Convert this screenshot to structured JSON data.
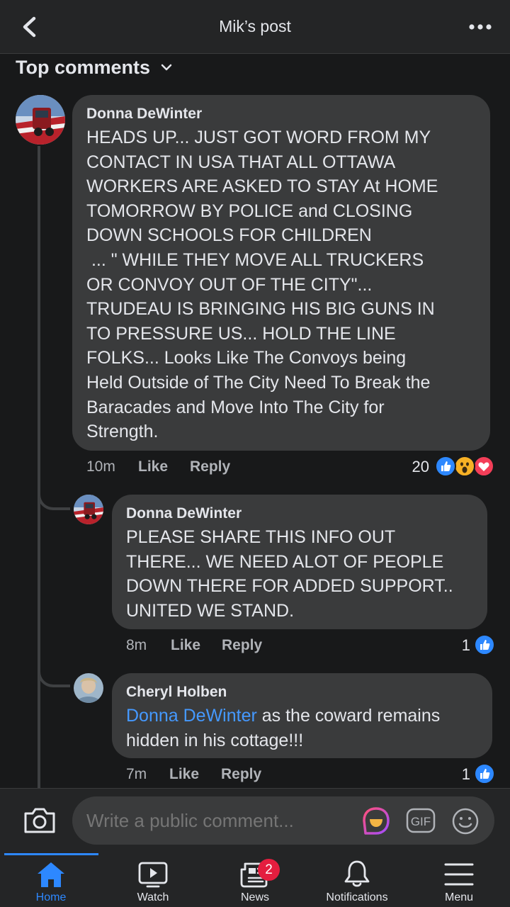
{
  "header": {
    "title": "Mik’s post"
  },
  "filter": {
    "label": "Top comments"
  },
  "comments": [
    {
      "author": "Donna DeWinter",
      "lines": [
        "HEADS UP... JUST GOT WORD FROM MY",
        "CONTACT IN USA THAT ALL OTTAWA",
        "WORKERS ARE ASKED TO STAY At HOME",
        "TOMORROW BY POLICE and CLOSING",
        "DOWN SCHOOLS FOR CHILDREN",
        " ... \" WHILE THEY MOVE ALL TRUCKERS",
        "OR CONVOY OUT OF THE CITY\"...",
        "TRUDEAU IS BRINGING HIS BIG GUNS IN",
        "TO PRESSURE US... HOLD THE LINE",
        "FOLKS... Looks Like The Convoys being",
        "Held Outside of The City Need To Break the",
        "Baracades and Move Into The City for",
        "Strength."
      ],
      "time": "10m",
      "like": "Like",
      "reply": "Reply",
      "reaction_count": "20"
    },
    {
      "author": "Donna DeWinter",
      "lines": [
        "PLEASE SHARE THIS INFO OUT",
        "THERE... WE NEED ALOT OF PEOPLE",
        "DOWN THERE FOR ADDED SUPPORT..",
        "UNITED WE STAND."
      ],
      "time": "8m",
      "like": "Like",
      "reply": "Reply",
      "reaction_count": "1"
    },
    {
      "author": "Cheryl Holben",
      "mention": "Donna DeWinter",
      "line1_rest": " as the coward remains",
      "line2": "hidden in his cottage!!!",
      "time": "7m",
      "like": "Like",
      "reply": "Reply",
      "reaction_count": "1"
    }
  ],
  "composer": {
    "placeholder": "Write a public comment..."
  },
  "tabs": [
    {
      "label": "Home",
      "icon": "home-icon"
    },
    {
      "label": "Watch",
      "icon": "watch-icon"
    },
    {
      "label": "News",
      "icon": "news-icon",
      "badge": "2"
    },
    {
      "label": "Notifications",
      "icon": "bell-icon"
    },
    {
      "label": "Menu",
      "icon": "menu-icon"
    }
  ],
  "colors": {
    "accent": "#2d88ff",
    "bubble": "#3a3b3c",
    "background": "#18191a",
    "mention": "#4599ff",
    "badge": "#e41e3f"
  }
}
